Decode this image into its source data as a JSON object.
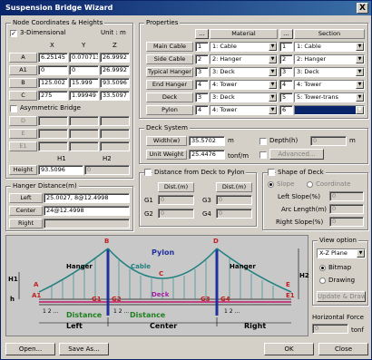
{
  "window": {
    "title": "Suspension Bridge Wizard",
    "close_glyph": "X"
  },
  "node": {
    "title": "Node Coordinates & Heights",
    "three_dim_label": "3-Dimensional",
    "three_dim_checked": true,
    "unit_label": "Unit : m",
    "headers": [
      "X",
      "Y",
      "Z"
    ],
    "rows": [
      {
        "label": "A",
        "x": "6.25145",
        "y": "0.0707136",
        "z": "26.9992"
      },
      {
        "label": "A1",
        "x": "0",
        "y": "0",
        "z": "26.9992"
      },
      {
        "label": "B",
        "x": "125.002",
        "y": "15.999",
        "z": "93.5096"
      },
      {
        "label": "C",
        "x": "275",
        "y": "1.99949",
        "z": "33.5097"
      }
    ],
    "asym_label": "Asymmetric Bridge",
    "asym_checked": false,
    "asym_rows": [
      "D",
      "E",
      "E1"
    ],
    "h_headers": [
      "H1",
      "H2"
    ],
    "height_label": "Height",
    "height_h1": "93.5096",
    "height_h2": "0"
  },
  "hanger": {
    "title": "Hanger Distance(m)",
    "rows": [
      {
        "label": "Left",
        "value": "25.0027, 8@12.4998"
      },
      {
        "label": "Center",
        "value": "24@12.4998"
      },
      {
        "label": "Right",
        "value": ""
      }
    ]
  },
  "properties": {
    "title": "Properties",
    "btn": "...",
    "material_header": "Material",
    "section_header": "Section",
    "rows": [
      {
        "label": "Main Cable",
        "mat_no": "1",
        "mat": "1: Cable",
        "sec_no": "1",
        "sec": "1: Cable"
      },
      {
        "label": "Side Cable",
        "mat_no": "2",
        "mat": "2: Hanger",
        "sec_no": "2",
        "sec": "2: Hanger"
      },
      {
        "label": "Typical Hanger",
        "mat_no": "3",
        "mat": "3: Deck",
        "sec_no": "3",
        "sec": "3: Deck"
      },
      {
        "label": "End Hanger",
        "mat_no": "4",
        "mat": "4: Tower",
        "sec_no": "4",
        "sec": "4: Tower"
      },
      {
        "label": "Deck",
        "mat_no": "3",
        "mat": "3: Deck",
        "sec_no": "5",
        "sec": "5: Tower-trans"
      },
      {
        "label": "Pylon",
        "mat_no": "4",
        "mat": "4: Tower",
        "sec_no": "6",
        "sec": ""
      }
    ]
  },
  "deck": {
    "title": "Deck System",
    "width_label": "Width(w)",
    "width": "35.5702",
    "width_unit": "m",
    "unit_weight_label": "Unit Weight",
    "unit_weight": "25.4476",
    "unit_weight_unit": "tonf/m",
    "depth_label": "Depth(h)",
    "depth": "0",
    "depth_unit": "m",
    "advanced": "Advanced..."
  },
  "dist": {
    "title": "Distance from Deck to Pylon",
    "header": "Dist.(m)",
    "rows": [
      [
        "G1",
        "0",
        "G3",
        "0"
      ],
      [
        "G2",
        "0",
        "G4",
        "0"
      ]
    ]
  },
  "shape": {
    "title": "Shape of Deck",
    "slope": "Slope",
    "coord": "Coordinate",
    "left_slope_label": "Left Slope(%)",
    "left_slope": "0",
    "arc_label": "Arc Length(m)",
    "arc": "0",
    "right_slope_label": "Right Slope(%)",
    "right_slope": "0"
  },
  "diagram": {
    "pylon": "Pylon",
    "hanger_l": "Hanger",
    "hanger_r": "Hanger",
    "cable": "Cable",
    "deck": "Deck",
    "B": "B",
    "C": "C",
    "D": "D",
    "A": "A",
    "A1": "A1",
    "E": "E",
    "E1": "E1",
    "H1": "H1",
    "H2": "H2",
    "h": "h",
    "G1": "G1",
    "G2": "G2",
    "G3": "G3",
    "G4": "G4",
    "distance_l": "Distance",
    "distance_r": "Distance",
    "left": "Left",
    "center": "Center",
    "right": "Right",
    "n12": "1 2 ...",
    "n12b": "1 2 ...",
    "n12c": "1 2 ..."
  },
  "view": {
    "title": "View option",
    "plane": "X-Z Plane",
    "bitmap": "Bitmap",
    "drawing": "Drawing",
    "update": "Update & Draw"
  },
  "hforce": {
    "title": "Horizontal Force",
    "value": "0",
    "unit": "tonf"
  },
  "buttons": {
    "open": "Open...",
    "save_as": "Save As...",
    "ok": "OK",
    "close": "Close"
  }
}
